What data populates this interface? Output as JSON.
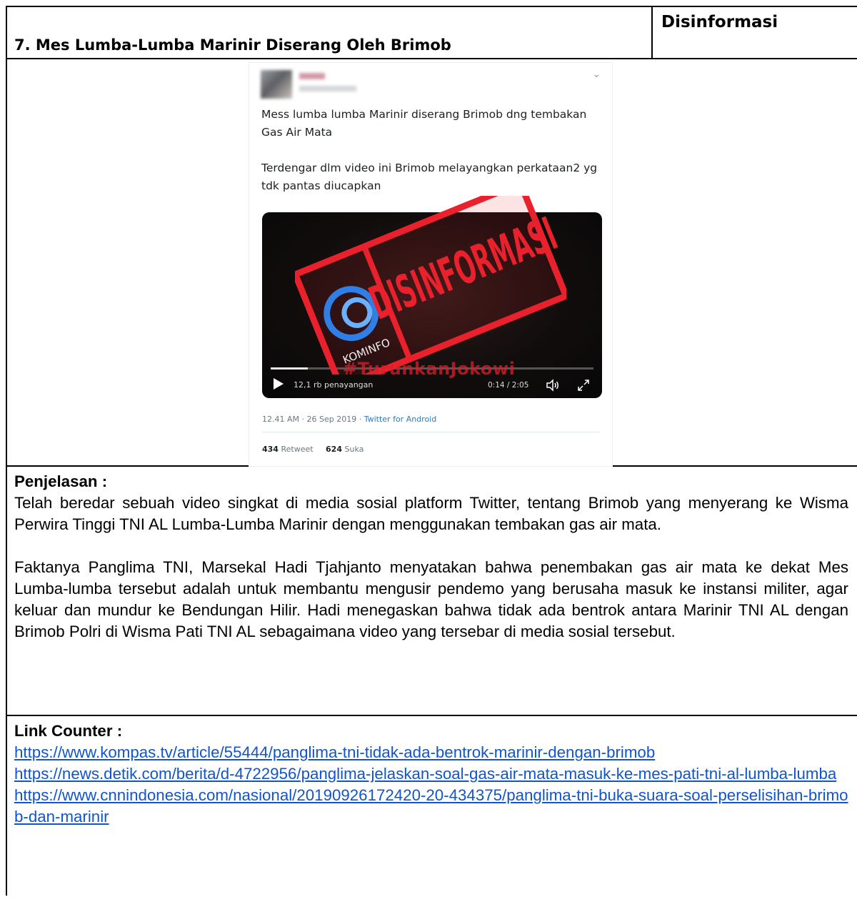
{
  "title": "7. Mes Lumba-Lumba Marinir Diserang Oleh Brimob",
  "status": "Disinformasi",
  "tweet": {
    "text_1": "Mess lumba lumba Marinir diserang Brimob dng tembakan Gas Air Mata",
    "text_2": "Terdengar dlm video ini Brimob melayangkan perkataan2 yg tdk pantas diucapkan",
    "views": "12,1 rb penayangan",
    "timecode": "0:14 / 2:05",
    "progress": 0.114,
    "datetime": "12.41 AM · 26 Sep 2019 · ",
    "source": "Twitter for Android",
    "retweets_count": "434",
    "retweets_label": "Retweet",
    "likes_count": "624",
    "likes_label": "Suka",
    "stamp_text": "DISINFORMASI",
    "stamp_logo": "KOMINFO",
    "hashtag": "#TurunkanJokowi",
    "stamp_color": "#e8212c"
  },
  "explanation": {
    "heading": "Penjelasan :",
    "para_1": "Telah beredar sebuah video singkat di media sosial platform Twitter, tentang Brimob yang menyerang ke Wisma Perwira Tinggi TNI AL Lumba-Lumba Marinir dengan menggunakan tembakan gas air mata.",
    "para_2": "Faktanya Panglima TNI, Marsekal Hadi Tjahjanto menyatakan bahwa penembakan gas air mata ke dekat Mes Lumba-lumba tersebut adalah untuk membantu mengusir pendemo yang berusaha masuk ke instansi militer, agar keluar dan mundur ke Bendungan Hilir. Hadi menegaskan bahwa tidak ada bentrok antara Marinir TNI AL dengan Brimob Polri di Wisma Pati TNI AL sebagaimana video yang tersebar di media sosial tersebut."
  },
  "links": {
    "heading": "Link Counter :",
    "items": [
      "https://www.kompas.tv/article/55444/panglima-tni-tidak-ada-bentrok-marinir-dengan-brimob",
      "https://news.detik.com/berita/d-4722956/panglima-jelaskan-soal-gas-air-mata-masuk-ke-mes-pati-tni-al-lumba-lumba",
      "https://www.cnnindonesia.com/nasional/20190926172420-20-434375/panglima-tni-buka-suara-soal-perselisihan-brimob-dan-marinir"
    ]
  }
}
